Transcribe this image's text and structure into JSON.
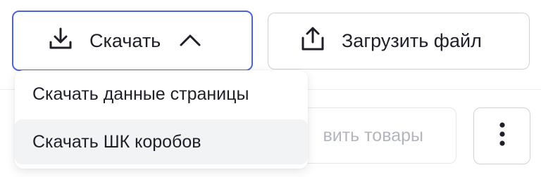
{
  "toolbar": {
    "download_label": "Скачать",
    "upload_label": "Загрузить файл",
    "add_products_label_partial": "вить товары"
  },
  "dropdown": {
    "items": [
      {
        "label": "Скачать данные страницы"
      },
      {
        "label": "Скачать ШК коробов"
      }
    ]
  },
  "icons": {
    "download": "download-icon",
    "upload": "upload-icon",
    "chevron": "chevron-up-icon",
    "more": "more-vertical-icon"
  },
  "colors": {
    "accent_border": "#4e62d9",
    "text": "#1f1f29",
    "muted_text": "#b3b6bd",
    "hover_bg": "#f2f3f5"
  }
}
